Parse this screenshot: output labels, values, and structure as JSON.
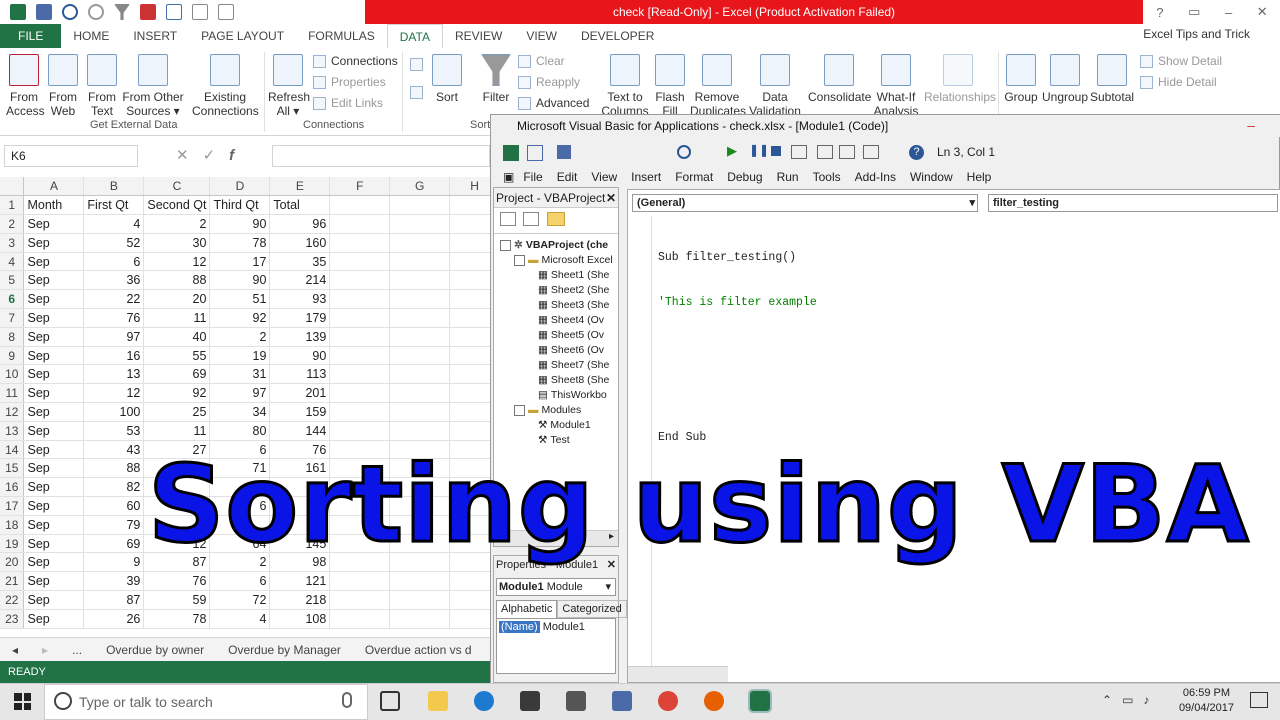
{
  "window": {
    "title": "check  [Read-Only] - Excel (Product Activation Failed)"
  },
  "ribbon_tabs": [
    "FILE",
    "HOME",
    "INSERT",
    "PAGE LAYOUT",
    "FORMULAS",
    "DATA",
    "REVIEW",
    "VIEW",
    "DEVELOPER"
  ],
  "account": "Excel Tips and Trick",
  "ribbon": {
    "from_access": [
      "From",
      "Access"
    ],
    "from_web": [
      "From",
      "Web"
    ],
    "from_text": [
      "From",
      "Text"
    ],
    "from_other": [
      "From Other",
      "Sources ▾"
    ],
    "existing": [
      "Existing",
      "Connections"
    ],
    "get_external_label": "Get External Data",
    "refresh": [
      "Refresh",
      "All ▾"
    ],
    "connections": "Connections",
    "properties": "Properties",
    "edit_links": "Edit Links",
    "connections_label": "Connections",
    "sort": "Sort",
    "filter": "Filter",
    "clear": "Clear",
    "reapply": "Reapply",
    "advanced": "Advanced",
    "sort_label": "Sort",
    "text_to_columns": [
      "Text to",
      "Columns"
    ],
    "flash_fill": [
      "Flash",
      "Fill"
    ],
    "remove_dup": [
      "Remove",
      "Duplicates"
    ],
    "data_validation": [
      "Data",
      "Validation ▾"
    ],
    "consolidate": "Consolidate",
    "what_if": [
      "What-If",
      "Analysis ▾"
    ],
    "relationships": "Relationships",
    "group": "Group",
    "ungroup": "Ungroup",
    "subtotal": "Subtotal",
    "show_detail": "Show Detail",
    "hide_detail": "Hide Detail"
  },
  "namebox": "K6",
  "columns": [
    "A",
    "B",
    "C",
    "D",
    "E",
    "F",
    "G",
    "H"
  ],
  "rows": [
    [
      "1",
      "Month",
      "First Qt",
      "Second Qt",
      "Third Qt",
      "Total"
    ],
    [
      "2",
      "Sep",
      "4",
      "2",
      "90",
      "96"
    ],
    [
      "3",
      "Sep",
      "52",
      "30",
      "78",
      "160"
    ],
    [
      "4",
      "Sep",
      "6",
      "12",
      "17",
      "35"
    ],
    [
      "5",
      "Sep",
      "36",
      "88",
      "90",
      "214"
    ],
    [
      "6",
      "Sep",
      "22",
      "20",
      "51",
      "93"
    ],
    [
      "7",
      "Sep",
      "76",
      "11",
      "92",
      "179"
    ],
    [
      "8",
      "Sep",
      "97",
      "40",
      "2",
      "139"
    ],
    [
      "9",
      "Sep",
      "16",
      "55",
      "19",
      "90"
    ],
    [
      "10",
      "Sep",
      "13",
      "69",
      "31",
      "113"
    ],
    [
      "11",
      "Sep",
      "12",
      "92",
      "97",
      "201"
    ],
    [
      "12",
      "Sep",
      "100",
      "25",
      "34",
      "159"
    ],
    [
      "13",
      "Sep",
      "53",
      "11",
      "80",
      "144"
    ],
    [
      "14",
      "Sep",
      "43",
      "27",
      "6",
      "76"
    ],
    [
      "15",
      "Sep",
      "88",
      "",
      "71",
      "161"
    ],
    [
      "16",
      "Sep",
      "82",
      "",
      "",
      ""
    ],
    [
      "17",
      "Sep",
      "60",
      "",
      "6",
      ""
    ],
    [
      "18",
      "Sep",
      "79",
      "",
      "",
      ""
    ],
    [
      "19",
      "Sep",
      "69",
      "12",
      "64",
      "145"
    ],
    [
      "20",
      "Sep",
      "9",
      "87",
      "2",
      "98"
    ],
    [
      "21",
      "Sep",
      "39",
      "76",
      "6",
      "121"
    ],
    [
      "22",
      "Sep",
      "87",
      "59",
      "72",
      "218"
    ],
    [
      "23",
      "Sep",
      "26",
      "78",
      "4",
      "108"
    ]
  ],
  "sheet_tabs": [
    "...",
    "Overdue by owner",
    "Overdue by Manager",
    "Overdue action vs d"
  ],
  "status": "READY",
  "vba": {
    "title": "Microsoft Visual Basic for Applications - check.xlsx - [Module1 (Code)]",
    "position": "Ln 3, Col 1",
    "menu": [
      "File",
      "Edit",
      "View",
      "Insert",
      "Format",
      "Debug",
      "Run",
      "Tools",
      "Add-Ins",
      "Window",
      "Help"
    ],
    "project_title": "Project - VBAProject",
    "tree": {
      "root": "VBAProject (che",
      "excel_objects": "Microsoft Excel",
      "sheets": [
        "Sheet1 (She",
        "Sheet2 (She",
        "Sheet3 (She",
        "Sheet4 (Ov",
        "Sheet5 (Ov",
        "Sheet6 (Ov",
        "Sheet7 (She",
        "Sheet8 (She",
        "ThisWorkbo"
      ],
      "modules": "Modules",
      "module_items": [
        "Module1",
        "Test"
      ]
    },
    "props_title": "Properties - Module1",
    "props_object": "Module1",
    "props_type": "Module",
    "props_tabs": [
      "Alphabetic",
      "Categorized"
    ],
    "props_name_key": "(Name)",
    "props_name_val": "Module1",
    "combo_left": "(General)",
    "combo_right": "filter_testing",
    "code": [
      "Sub filter_testing()",
      "'This is filter example",
      "",
      "",
      "End Sub"
    ]
  },
  "overlay": "Sorting using VBA",
  "taskbar": {
    "search": "Type or talk to search",
    "time": "06:59 PM",
    "date": "09/04/2017"
  }
}
